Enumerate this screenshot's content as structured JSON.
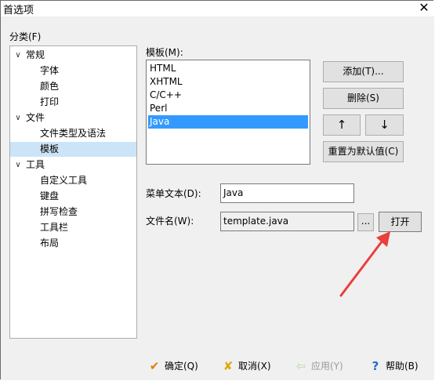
{
  "window": {
    "title": "首选项",
    "close_glyph": "✕"
  },
  "category": {
    "label": "分类(F)",
    "tree": [
      {
        "label": "常规",
        "toggle": "∨",
        "children": [
          "字体",
          "颜色",
          "打印"
        ]
      },
      {
        "label": "文件",
        "toggle": "∨",
        "children": [
          "文件类型及语法",
          "模板"
        ]
      },
      {
        "label": "工具",
        "toggle": "∨",
        "children": [
          "自定义工具",
          "键盘",
          "拼写检查",
          "工具栏",
          "布局"
        ]
      }
    ],
    "selected": "模板"
  },
  "templates": {
    "label": "模板(M):",
    "items": [
      "HTML",
      "XHTML",
      "C/C++",
      "Perl",
      "Java"
    ],
    "selected": "Java"
  },
  "buttons": {
    "add": "添加(T)...",
    "delete": "删除(S)",
    "up": "↑",
    "down": "↓",
    "reset": "重置为默认值(C)",
    "browse": "...",
    "open": "打开"
  },
  "fields": {
    "menu_text_label": "菜单文本(D):",
    "menu_text_value": "Java",
    "filename_label": "文件名(W):",
    "filename_value": "template.java"
  },
  "dialog_buttons": {
    "ok": "确定(Q)",
    "cancel": "取消(X)",
    "apply": "应用(Y)",
    "help": "帮助(B)"
  },
  "colors": {
    "selection_blue": "#3399ff",
    "tree_selection": "#cce4f7",
    "annotation_red": "#e8403a"
  }
}
